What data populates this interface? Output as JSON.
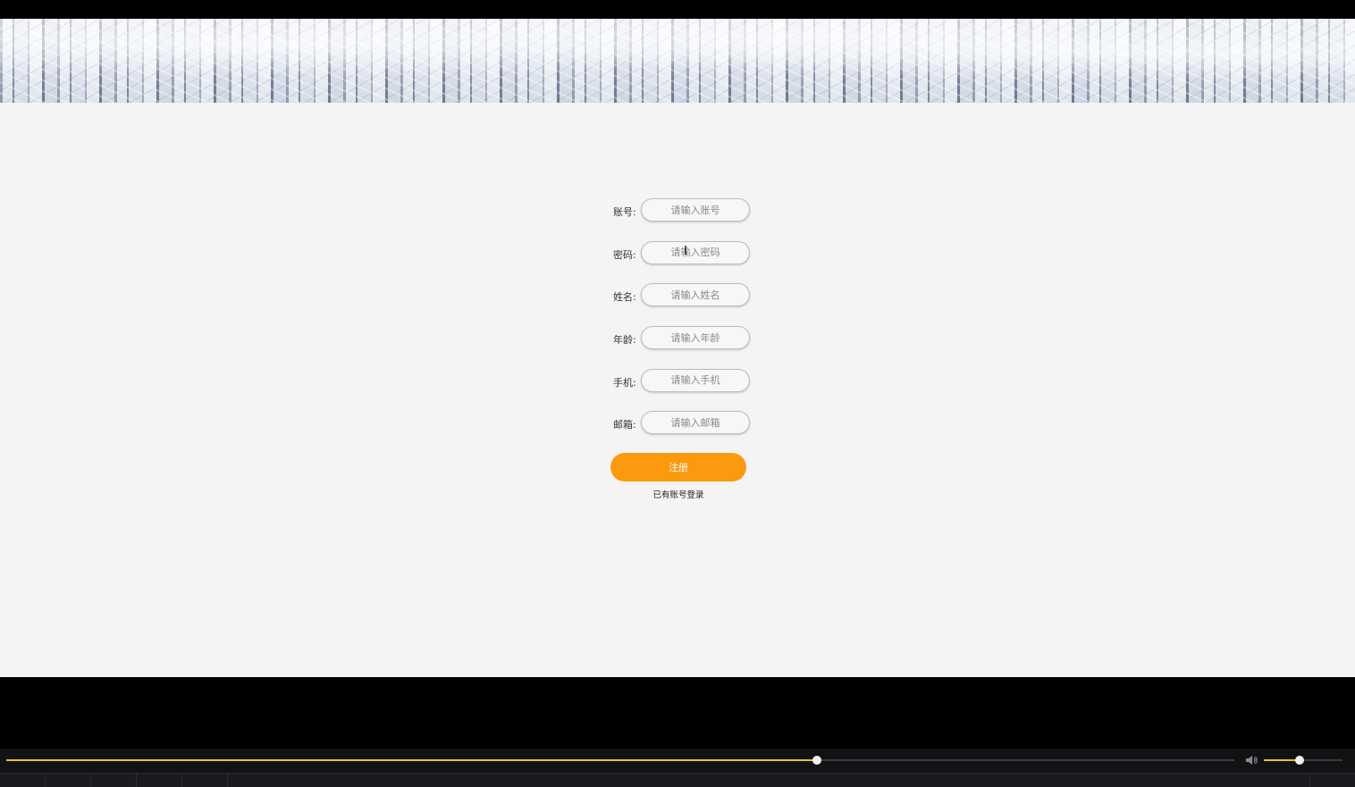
{
  "form": {
    "fields": [
      {
        "label": "账号:",
        "placeholder": "请输入账号"
      },
      {
        "label": "密码:",
        "placeholder": "请输入密码"
      },
      {
        "label": "姓名:",
        "placeholder": "请输入姓名"
      },
      {
        "label": "年龄:",
        "placeholder": "请输入年龄"
      },
      {
        "label": "手机:",
        "placeholder": "请输入手机"
      },
      {
        "label": "邮箱:",
        "placeholder": "请输入邮箱"
      }
    ],
    "register_label": "注册",
    "login_link": "已有账号登录"
  },
  "player": {
    "progress_fraction": 0.66,
    "volume_fraction": 0.45,
    "accent_color": "#e9c320"
  },
  "colors": {
    "button": "#fb9a0f",
    "page_background": "#f4f4f4"
  }
}
